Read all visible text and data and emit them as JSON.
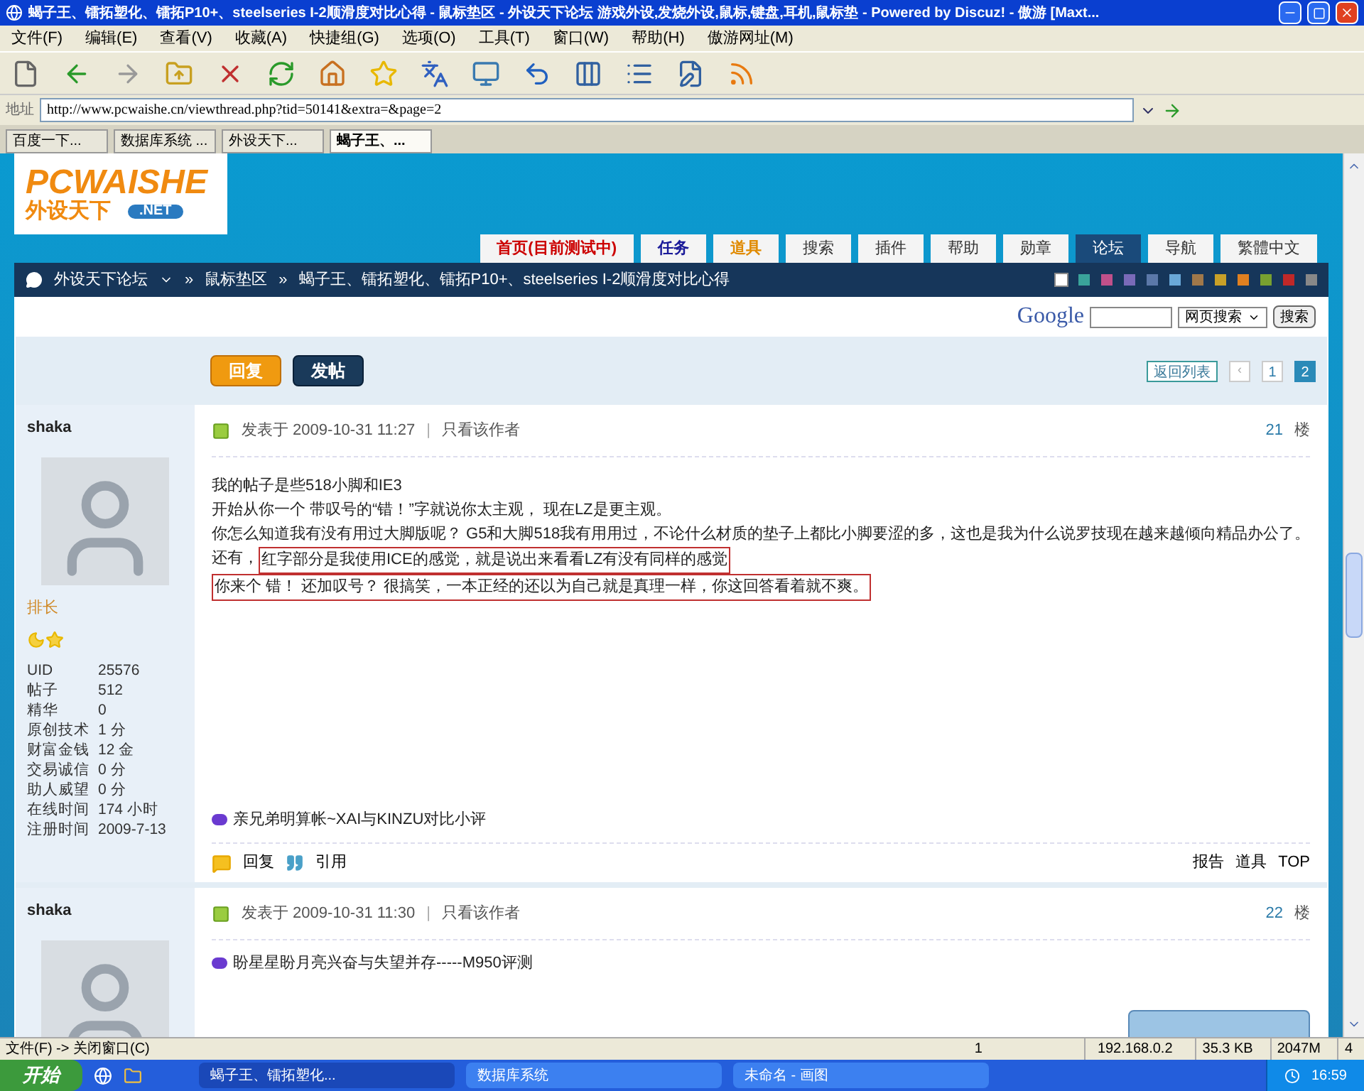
{
  "window": {
    "title": "蝎子王、镭拓塑化、镭拓P10+、steelseries I-2顺滑度对比心得 - 鼠标垫区 - 外设天下论坛 游戏外设,发烧外设,鼠标,键盘,耳机,鼠标垫 - Powered by Discuz! - 傲游 [Maxt..."
  },
  "menu": [
    "文件(F)",
    "编辑(E)",
    "查看(V)",
    "收藏(A)",
    "快捷组(G)",
    "选项(O)",
    "工具(T)",
    "窗口(W)",
    "帮助(H)",
    "傲游网址(M)"
  ],
  "address": {
    "label": "地址",
    "url": "http://www.pcwaishe.cn/viewthread.php?tid=50141&extra=&page=2"
  },
  "tabs": [
    {
      "label": "百度一下...",
      "selected": false
    },
    {
      "label": "数据库系统 ...",
      "selected": false
    },
    {
      "label": "外设天下...",
      "selected": false
    },
    {
      "label": "蝎子王、...",
      "selected": true
    }
  ],
  "logo": {
    "name": "PCWAISHE",
    "sub": "外设天下",
    "net": ".NET"
  },
  "nav": [
    {
      "label": "首页(目前测试中)",
      "selected": false,
      "color": "#cc0000"
    },
    {
      "label": "任务",
      "selected": false,
      "color": "#1a1a99"
    },
    {
      "label": "道具",
      "selected": false,
      "color": "#e08a00"
    },
    {
      "label": "搜索",
      "selected": false
    },
    {
      "label": "插件",
      "selected": false
    },
    {
      "label": "帮助",
      "selected": false
    },
    {
      "label": "勋章",
      "selected": false
    },
    {
      "label": "论坛",
      "selected": true
    },
    {
      "label": "导航",
      "selected": false
    },
    {
      "label": "繁體中文",
      "selected": false
    }
  ],
  "breadcrumb_separators": [
    "»",
    "»"
  ],
  "breadcrumb": [
    "外设天下论坛",
    "鼠标垫区",
    "蝎子王、镭拓塑化、镭拓P10+、steelseries I-2顺滑度对比心得"
  ],
  "swatches": [
    {
      "color": "#ffffff",
      "selected": true
    },
    {
      "color": "#3aa39a",
      "selected": false
    },
    {
      "color": "#c0508a",
      "selected": false
    },
    {
      "color": "#7a6ab8",
      "selected": false
    },
    {
      "color": "#5b78a8",
      "selected": false
    },
    {
      "color": "#6aa8d8",
      "selected": false
    },
    {
      "color": "#a0784a",
      "selected": false
    },
    {
      "color": "#c8a028",
      "selected": false
    },
    {
      "color": "#e08020",
      "selected": false
    },
    {
      "color": "#78a030",
      "selected": false
    },
    {
      "color": "#c02828",
      "selected": false
    },
    {
      "color": "#888888",
      "selected": false
    }
  ],
  "search": {
    "logo": "Google",
    "scope": "网页搜索",
    "button": "搜索"
  },
  "actions": [
    "回复",
    "发帖"
  ],
  "pagination": {
    "back": "返回列表",
    "previous": "‹",
    "pages": [
      {
        "label": "1",
        "selected": false
      },
      {
        "label": "2",
        "selected": true
      }
    ]
  },
  "posts": [
    {
      "author": "shaka",
      "rank": "排长",
      "stats": [
        {
          "label": "UID",
          "value": "25576"
        },
        {
          "label": "帖子",
          "value": "512"
        },
        {
          "label": "精华",
          "value": "0"
        },
        {
          "label": "原创技术",
          "value": "1 分"
        },
        {
          "label": "财富金钱",
          "value": "12 金"
        },
        {
          "label": "交易诚信",
          "value": "0 分"
        },
        {
          "label": "助人威望",
          "value": "0 分"
        },
        {
          "label": "在线时间",
          "value": "174 小时"
        },
        {
          "label": "注册时间",
          "value": "2009-7-13"
        }
      ],
      "posted": "发表于 2009-10-31 11:27",
      "separator": "|",
      "only_author": "只看该作者",
      "floor": "21",
      "floor_unit": "楼",
      "lines": [
        [
          {
            "text": "我的帖子是些518小脚和IE3",
            "boxed": false
          }
        ],
        [
          {
            "text": "开始从你一个 带叹号的“错！”字就说你太主观， 现在LZ是更主观。",
            "boxed": false
          }
        ],
        [
          {
            "text": "你怎么知道我有没有用过大脚版呢？  G5和大脚518我有用用过，不论什么材质的垫子上都比小脚要涩的多，这也是我为什么说罗技现在越来越倾向精品办公了。",
            "boxed": false
          }
        ],
        [
          {
            "text": "还有，",
            "boxed": false
          },
          {
            "text": "红字部分是我使用ICE的感觉，就是说出来看看LZ有没有同样的感觉",
            "boxed": true
          }
        ],
        [
          {
            "text": "你来个 错！ 还加叹号？ 很搞笑，一本正经的还以为自己就是真理一样，你这回答看着就不爽。",
            "boxed": true
          }
        ]
      ],
      "ad": "亲兄弟明算帐~XAI与KINZU对比小评",
      "replies": [
        "回复",
        "引用"
      ],
      "tools": [
        "报告",
        "道具",
        "TOP"
      ]
    },
    {
      "author": "shaka",
      "posted": "发表于 2009-10-31 11:30",
      "separator": "|",
      "only_author": "只看该作者",
      "floor": "22",
      "floor_unit": "楼",
      "ad": "盼星星盼月亮兴奋与失望并存-----M950评测"
    }
  ],
  "status_bar": {
    "text": "文件(F) -> 关闭窗口(C)",
    "count": "1",
    "ip": "192.168.0.2",
    "size": "35.3 KB",
    "memory": "2047M",
    "number": "4"
  },
  "taskbar": {
    "start": "开始",
    "tasks": [
      {
        "label": "蝎子王、镭拓塑化...",
        "selected": true
      },
      {
        "label": "数据库系统",
        "selected": false
      },
      {
        "label": "未命名 - 画图",
        "selected": false
      }
    ],
    "time": "16:59"
  }
}
